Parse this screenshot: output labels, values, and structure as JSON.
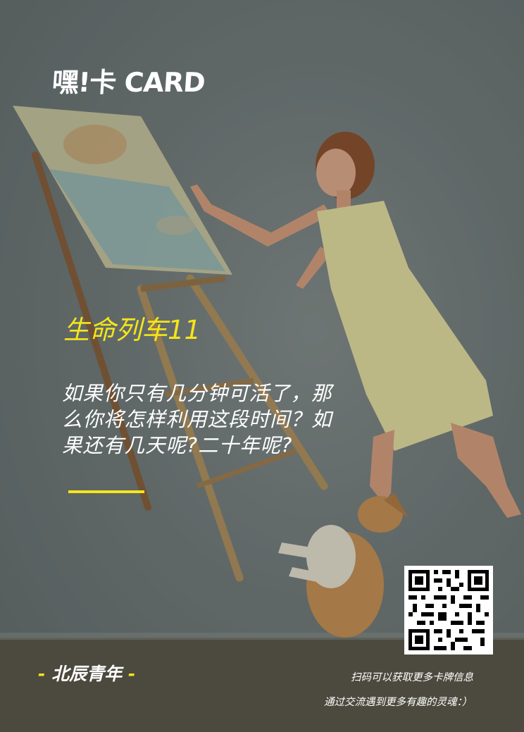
{
  "logo": {
    "text": "嘿!卡 CARD"
  },
  "card": {
    "title": "生命列车11",
    "question_lines": [
      "如果你只有几分钟可活了，那",
      "么你将怎样利用这段时间？如",
      "果还有几天呢?二十年呢?"
    ]
  },
  "footer": {
    "brand_dash_left": "-",
    "brand_name": "北辰青年",
    "brand_dash_right": "-",
    "caption_line1": "扫码可以获取更多卡牌信息",
    "caption_line2": "通过交流遇到更多有趣的灵魂：）"
  },
  "colors": {
    "accent_yellow": "#f5e51a",
    "text_white": "#ffffff",
    "background_gray": "#6b7373"
  },
  "icons": {
    "qr": "qr-code-icon"
  }
}
